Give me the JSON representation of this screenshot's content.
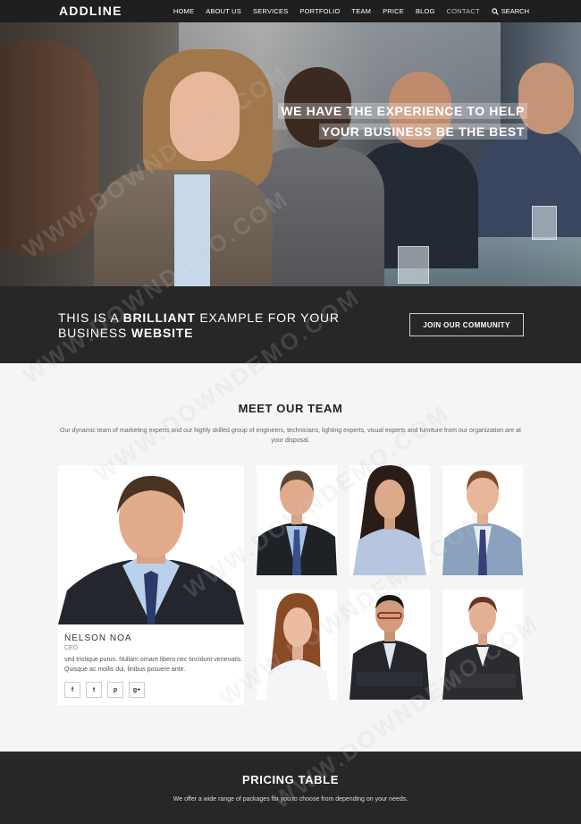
{
  "nav": {
    "logo": "ADDLINE",
    "items": [
      {
        "label": "HOME"
      },
      {
        "label": "ABOUT US"
      },
      {
        "label": "SERVICES"
      },
      {
        "label": "PORTFOLIO"
      },
      {
        "label": "TEAM"
      },
      {
        "label": "PRICE"
      },
      {
        "label": "BLOG"
      },
      {
        "label": "CONTACT"
      }
    ],
    "search_label": "SEARCH"
  },
  "hero": {
    "line1": "WE HAVE THE EXPERIENCE TO HELP",
    "line2": "YOUR BUSINESS BE THE BEST"
  },
  "cta": {
    "p1": "THIS IS A ",
    "b1": "BRILLIANT",
    "p2": " EXAMPLE FOR YOUR",
    "p3": "BUSINESS ",
    "b2": "WEBSITE",
    "button": "JOIN OUR COMMUNITY"
  },
  "team": {
    "title": "MEET OUR TEAM",
    "description": "Our dynamic team of marketing experts and our highly skilled group of engineers, technicians, lighting experts, visual experts and furniture from our organization are at your disposal.",
    "featured": {
      "name": "NELSON NOA",
      "role": "CEO",
      "bio": "sed tristique purus. Nullam ornare libero nec tincidunt venenatis. Quisque ac mollis dui, finibus posuere ante."
    },
    "socials": [
      {
        "glyph": "f",
        "icon": "facebook-icon"
      },
      {
        "glyph": "t",
        "icon": "twitter-icon"
      },
      {
        "glyph": "p",
        "icon": "pinterest-icon"
      },
      {
        "glyph": "g+",
        "icon": "google-plus-icon"
      }
    ]
  },
  "pricing": {
    "title": "PRICING TABLE",
    "description": "We offer a wide range of packages for you to choose from depending on your needs."
  },
  "watermark": "WWW.DOWNDEMO.COM",
  "colors": {
    "nav_bg": "#1f1f1f",
    "band_bg": "#272727",
    "page_bg": "#f5f5f5"
  }
}
